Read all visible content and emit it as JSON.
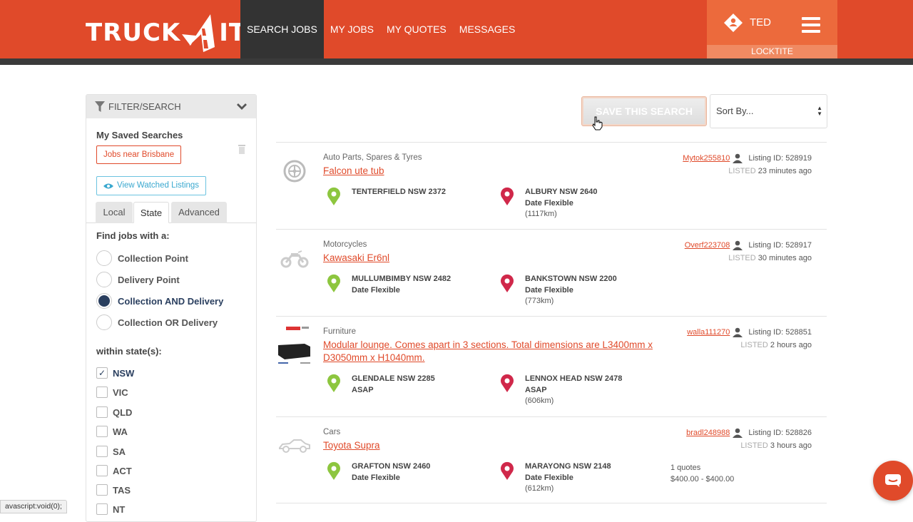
{
  "brand": {
    "left": "TRUCK",
    "right": "IT"
  },
  "nav": {
    "items": [
      {
        "label": "SEARCH JOBS",
        "active": true
      },
      {
        "label": "MY JOBS"
      },
      {
        "label": "MY QUOTES"
      },
      {
        "label": "MESSAGES"
      }
    ]
  },
  "user": {
    "name": "TED",
    "company": "LOCKTITE"
  },
  "filter": {
    "header": "FILTER/SEARCH",
    "saved_title": "My Saved Searches",
    "saved_items": [
      "Jobs near Brisbane"
    ],
    "watched_label": "View Watched Listings",
    "tabs": [
      "Local",
      "State",
      "Advanced"
    ],
    "active_tab": "State",
    "find_title": "Find jobs with a:",
    "radio_options": [
      "Collection Point",
      "Delivery Point",
      "Collection AND Delivery",
      "Collection OR Delivery"
    ],
    "radio_selected": "Collection AND Delivery",
    "within_title": "within state(s):",
    "states": [
      {
        "label": "NSW",
        "checked": true
      },
      {
        "label": "VIC",
        "checked": false
      },
      {
        "label": "QLD",
        "checked": false
      },
      {
        "label": "WA",
        "checked": false
      },
      {
        "label": "SA",
        "checked": false
      },
      {
        "label": "ACT",
        "checked": false
      },
      {
        "label": "TAS",
        "checked": false
      },
      {
        "label": "NT",
        "checked": false
      }
    ]
  },
  "toolbar": {
    "save_search_label": "SAVE THIS SEARCH",
    "sort_label": "Sort By..."
  },
  "listings": [
    {
      "category": "Auto Parts, Spares & Tyres",
      "title": "Falcon ute tub",
      "icon": "tyre-icon",
      "pickup": {
        "place": "TENTERFIELD NSW 2372",
        "when": ""
      },
      "dropoff": {
        "place": "ALBURY NSW 2640",
        "when": "Date Flexible",
        "distance": "(1117km)"
      },
      "user": "Mytok255810",
      "listing_id": "Listing ID: 528919",
      "listed_label": "LISTED",
      "listed_ago": "23 minutes ago",
      "quotes": "",
      "price": ""
    },
    {
      "category": "Motorcycles",
      "title": "Kawasaki Er6nl",
      "icon": "motorcycle-icon",
      "pickup": {
        "place": "MULLUMBIMBY NSW 2482",
        "when": "Date Flexible"
      },
      "dropoff": {
        "place": "BANKSTOWN NSW 2200",
        "when": "Date Flexible",
        "distance": "(773km)"
      },
      "user": "Overf223708",
      "listing_id": "Listing ID: 528917",
      "listed_label": "LISTED",
      "listed_ago": "30 minutes ago",
      "quotes": "",
      "price": ""
    },
    {
      "category": "Furniture",
      "title": "Modular lounge. Comes apart in 3 sections. Total dimensions are L3400mm x D3050mm x H1040mm.",
      "icon": "lounge-photo",
      "pickup": {
        "place": "GLENDALE NSW 2285",
        "when": "ASAP"
      },
      "dropoff": {
        "place": "LENNOX HEAD NSW 2478",
        "when": "ASAP",
        "distance": "(606km)"
      },
      "user": "walla111270",
      "listing_id": "Listing ID: 528851",
      "listed_label": "LISTED",
      "listed_ago": "2 hours ago",
      "quotes": "",
      "price": ""
    },
    {
      "category": "Cars",
      "title": "Toyota Supra",
      "icon": "car-icon",
      "pickup": {
        "place": "GRAFTON NSW 2460",
        "when": "Date Flexible"
      },
      "dropoff": {
        "place": "MARAYONG NSW 2148",
        "when": "Date Flexible",
        "distance": "(612km)"
      },
      "user": "bradl248988",
      "listing_id": "Listing ID: 528826",
      "listed_label": "LISTED",
      "listed_ago": "3 hours ago",
      "quotes": "1 quotes",
      "price": "$400.00 - $400.00"
    }
  ],
  "status_bar": "avascript:void(0);",
  "colors": {
    "brand": "#e04a2a",
    "pickup_pin": "#8dc63f",
    "dropoff_pin": "#d0284a",
    "selected": "#2a3f5f"
  }
}
